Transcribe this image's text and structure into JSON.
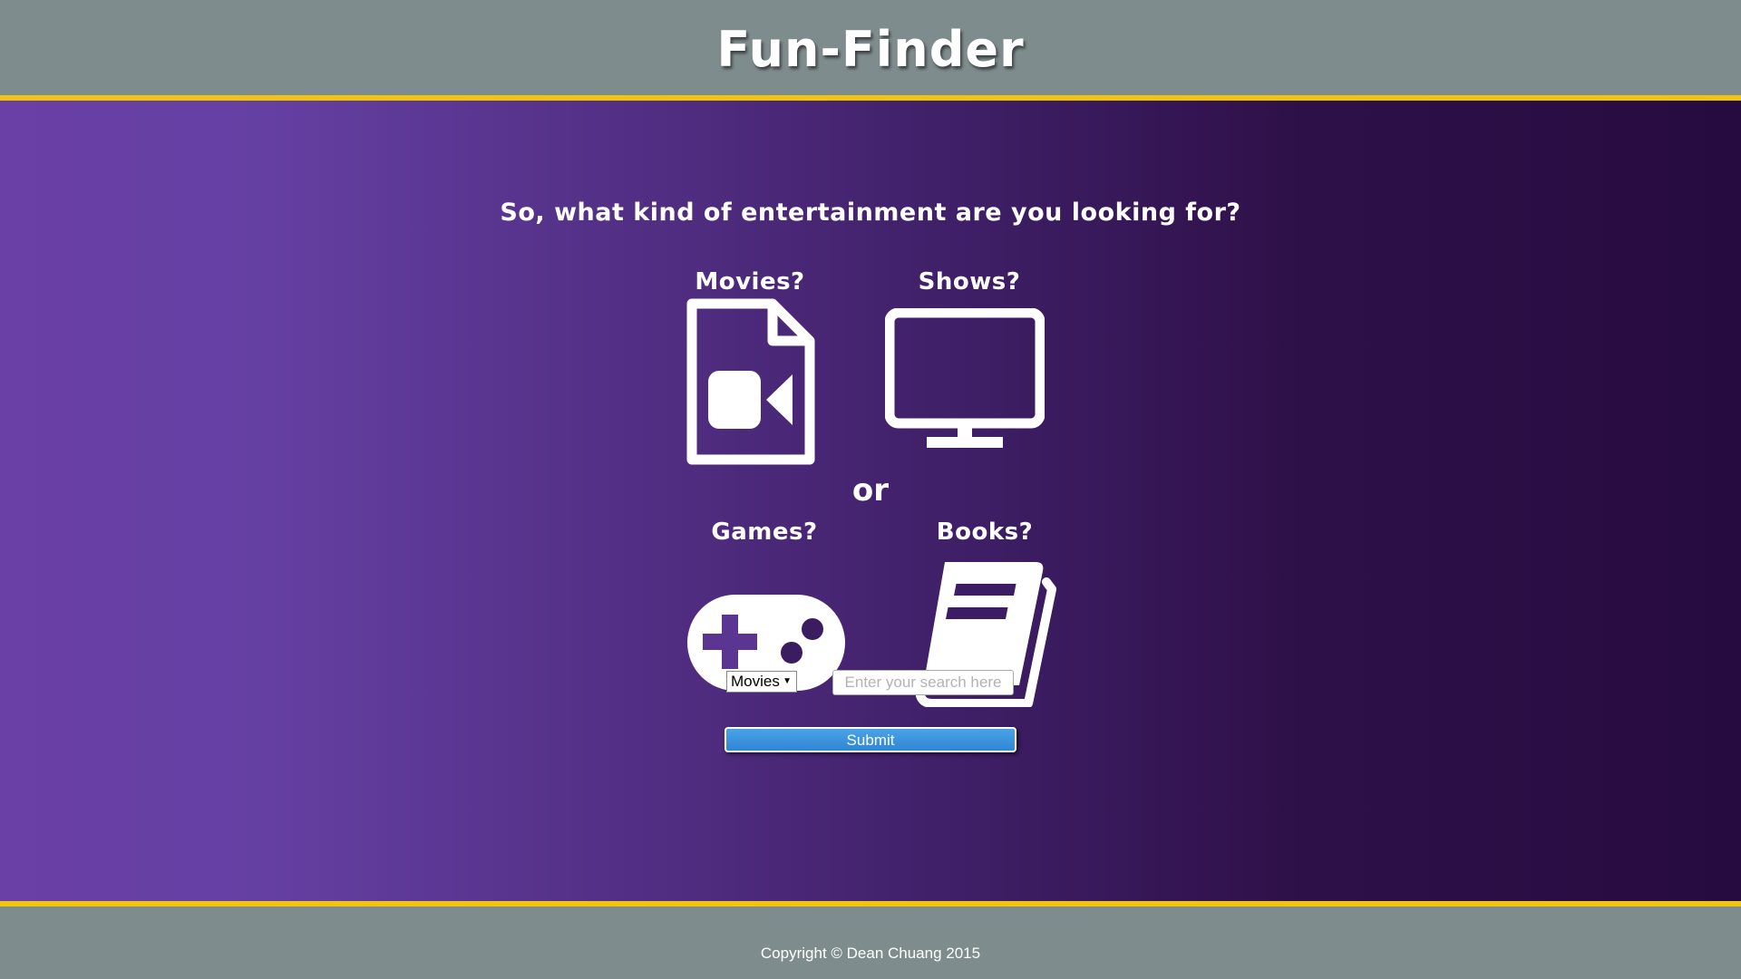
{
  "header": {
    "title": "Fun-Finder"
  },
  "main": {
    "question": "So, what kind of entertainment are you looking for?",
    "categories": [
      {
        "label": "Movies?",
        "icon": "movie-file-icon"
      },
      {
        "label": "Shows?",
        "icon": "tv-monitor-icon"
      },
      {
        "label": "Games?",
        "icon": "gamepad-icon"
      },
      {
        "label": "Books?",
        "icon": "book-icon"
      }
    ],
    "or_text": "or"
  },
  "search": {
    "category_selected": "Movies",
    "placeholder": "Enter your search here",
    "value": "",
    "submit_label": "Submit"
  },
  "footer": {
    "copyright": "Copyright © Dean Chuang 2015"
  },
  "colors": {
    "header_bg": "#7f8c8d",
    "accent_border": "#f1c40f",
    "gradient_start": "#6a3fa6",
    "gradient_end": "#260b40",
    "submit_blue": "#2f86d4"
  }
}
